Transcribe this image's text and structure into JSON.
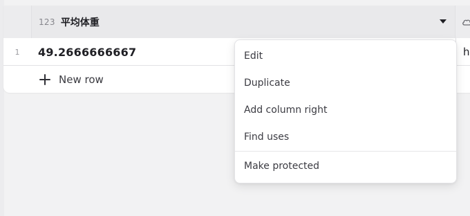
{
  "table": {
    "column": {
      "type_badge": "123",
      "name": "平均体重"
    },
    "rows": [
      {
        "number": "1",
        "value": "49.2666666667",
        "next_value": "h"
      }
    ],
    "new_row_label": "New row"
  },
  "context_menu": {
    "items": [
      {
        "label": "Edit"
      },
      {
        "label": "Duplicate"
      },
      {
        "label": "Add column right"
      },
      {
        "label": "Find uses"
      },
      {
        "label": "Make protected"
      }
    ]
  },
  "colors": {
    "background": "#f2f2f3",
    "header": "#e9e9eb",
    "text": "#1f1f24"
  },
  "icons": [
    "chevron-down-icon",
    "plus-icon",
    "cloud-icon"
  ]
}
